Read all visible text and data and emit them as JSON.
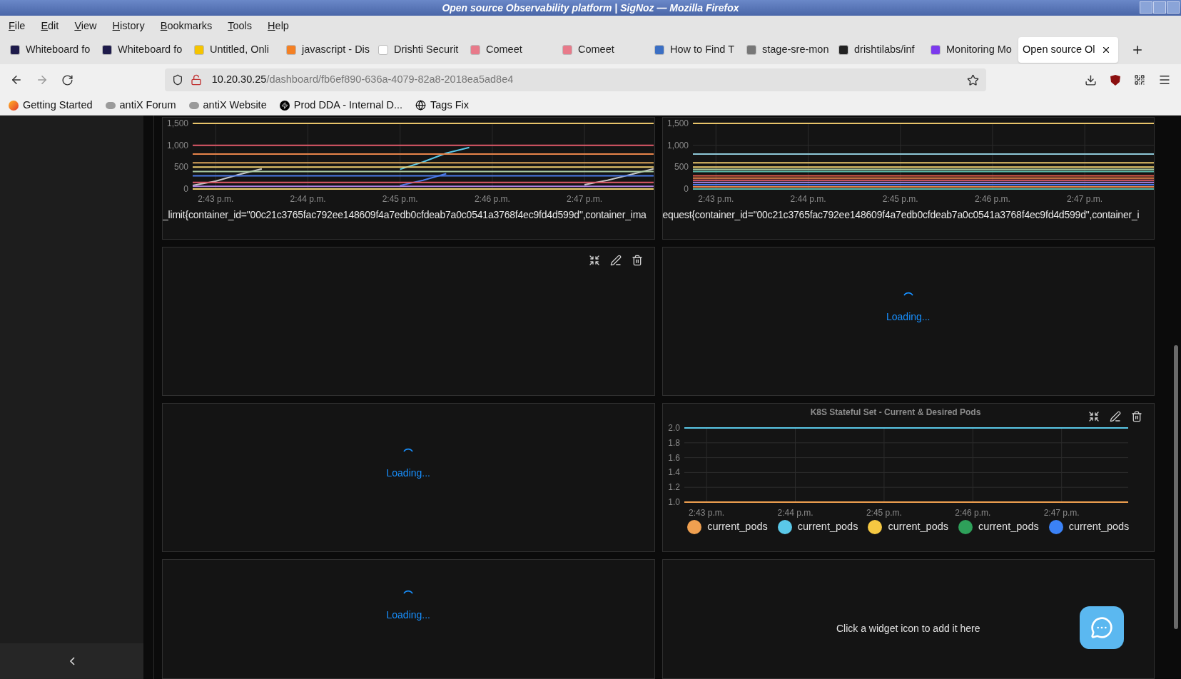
{
  "window": {
    "title": "Open source Observability platform | SigNoz — Mozilla Firefox"
  },
  "menu": [
    "File",
    "Edit",
    "View",
    "History",
    "Bookmarks",
    "Tools",
    "Help"
  ],
  "tabs": [
    {
      "label": "Whiteboard fo",
      "selected": false,
      "color": "#1e1b4b"
    },
    {
      "label": "Whiteboard fo",
      "selected": false,
      "color": "#1e1b4b"
    },
    {
      "label": "Untitled, Onli",
      "selected": false,
      "color": "#f5c400"
    },
    {
      "label": "javascript - Dis",
      "selected": false,
      "color": "#f48024"
    },
    {
      "label": "Drishti Securit",
      "selected": false,
      "color": "#ffffff"
    },
    {
      "label": "Comeet",
      "selected": false,
      "color": "#e87a8a"
    },
    {
      "label": "Comeet",
      "selected": false,
      "color": "#e87a8a"
    },
    {
      "label": "How to Find T",
      "selected": false,
      "color": "#3b6fc4"
    },
    {
      "label": "stage-sre-mon",
      "selected": false,
      "color": "#777777"
    },
    {
      "label": "drishtilabs/inf",
      "selected": false,
      "color": "#222222"
    },
    {
      "label": "Monitoring Mo",
      "selected": false,
      "color": "#7c3aed"
    },
    {
      "label": "Open source Ol",
      "selected": true
    }
  ],
  "address": {
    "host": "10.20.30.25",
    "path": "/dashboard/fb6ef890-636a-4079-82a8-2018ea5ad8e4"
  },
  "bookmarks": [
    "Getting Started",
    "antiX Forum",
    "antiX Website",
    "Prod DDA - Internal D...",
    "Tags Fix"
  ],
  "panels": [
    {
      "kind": "chart",
      "toolbar": false,
      "legend_text": "_limit{container_id=\"00c21c3765fac792ee148609f4a7edb0cfdeab7a0c0541a3768f4ec9fd4d599d\",container_ima",
      "chart_data": {
        "type": "line",
        "grid": true,
        "categories": [
          null,
          "2:43 p.m.",
          null,
          null,
          null,
          "2:44 p.m.",
          null,
          null,
          null,
          "2:45 p.m.",
          null,
          null,
          null,
          "2:46 p.m.",
          null,
          null,
          null,
          "2:47 p.m.",
          null,
          null,
          null
        ],
        "ylim": [
          0,
          1500
        ],
        "yticks": [
          {
            "value": 0,
            "label": "0"
          },
          {
            "value": 500,
            "label": "500"
          },
          {
            "value": 1000,
            "label": "1,000"
          },
          {
            "value": 1500,
            "label": "1,500"
          }
        ],
        "series": [
          {
            "color": "#e8c46a",
            "values": [
              1500,
              1500,
              1500,
              1500,
              1500,
              1500,
              1500,
              1500,
              1500,
              1500,
              1500,
              1500,
              1500,
              1500,
              1500,
              1500,
              1500,
              1500,
              1500,
              1500,
              1500
            ]
          },
          {
            "color": "#e05a6a",
            "values": [
              1000,
              1000,
              1000,
              1000,
              1000,
              1000,
              1000,
              1000,
              1000,
              1000,
              1000,
              1000,
              1000,
              1000,
              1000,
              1000,
              1000,
              1000,
              1000,
              1000,
              1000
            ]
          },
          {
            "color": "#e8844a",
            "values": [
              800,
              800,
              800,
              800,
              800,
              800,
              800,
              800,
              800,
              800,
              800,
              800,
              800,
              800,
              800,
              800,
              800,
              800,
              800,
              800,
              800
            ]
          },
          {
            "color": "#d9a55a",
            "values": [
              600,
              600,
              600,
              600,
              600,
              600,
              600,
              600,
              600,
              600,
              600,
              600,
              600,
              600,
              600,
              600,
              600,
              600,
              600,
              600,
              600
            ]
          },
          {
            "color": "#f0d070",
            "values": [
              500,
              500,
              500,
              500,
              500,
              500,
              500,
              500,
              500,
              500,
              500,
              500,
              500,
              500,
              500,
              500,
              500,
              500,
              500,
              500,
              500
            ]
          },
          {
            "color": "#a8c8a0",
            "values": [
              400,
              400,
              400,
              400,
              400,
              400,
              400,
              400,
              400,
              400,
              400,
              400,
              400,
              400,
              400,
              400,
              400,
              400,
              400,
              400,
              400
            ]
          },
          {
            "color": "#4a7ae8",
            "values": [
              300,
              300,
              300,
              300,
              300,
              300,
              300,
              300,
              300,
              300,
              300,
              300,
              300,
              300,
              300,
              300,
              300,
              300,
              300,
              300,
              300
            ]
          },
          {
            "color": "#e05a6a",
            "values": [
              150,
              150,
              150,
              150,
              150,
              150,
              150,
              150,
              150,
              150,
              150,
              150,
              150,
              150,
              150,
              150,
              150,
              150,
              150,
              150,
              150
            ]
          },
          {
            "color": "#b080e0",
            "values": [
              60,
              60,
              60,
              60,
              60,
              60,
              60,
              60,
              60,
              60,
              60,
              60,
              60,
              60,
              60,
              60,
              60,
              60,
              60,
              60,
              60
            ]
          },
          {
            "color": "#f0d070",
            "values": [
              0,
              0,
              0,
              0,
              0,
              0,
              0,
              0,
              0,
              0,
              0,
              0,
              0,
              0,
              0,
              0,
              0,
              0,
              0,
              0,
              0
            ]
          },
          {
            "color": "#5ac8e8",
            "values": [
              null,
              null,
              null,
              null,
              null,
              null,
              null,
              null,
              null,
              450,
              620,
              820,
              950,
              null,
              null,
              null,
              null,
              null,
              null,
              null,
              null
            ]
          },
          {
            "color": "#c8c8c8",
            "values": [
              80,
              180,
              330,
              460,
              null,
              null,
              null,
              null,
              null,
              null,
              null,
              null,
              null,
              null,
              null,
              null,
              null,
              100,
              200,
              330,
              460
            ]
          },
          {
            "color": "#4a7ae8",
            "values": [
              null,
              null,
              null,
              null,
              null,
              null,
              null,
              null,
              null,
              80,
              200,
              350,
              null,
              null,
              null,
              null,
              null,
              null,
              null,
              null,
              null
            ]
          }
        ]
      }
    },
    {
      "kind": "chart",
      "toolbar": false,
      "legend_text": "equest{container_id=\"00c21c3765fac792ee148609f4a7edb0cfdeab7a0c0541a3768f4ec9fd4d599d\",container_i",
      "chart_data": {
        "type": "line",
        "grid": true,
        "categories": [
          null,
          "2:43 p.m.",
          null,
          null,
          null,
          "2:44 p.m.",
          null,
          null,
          null,
          "2:45 p.m.",
          null,
          null,
          null,
          "2:46 p.m.",
          null,
          null,
          null,
          "2:47 p.m.",
          null,
          null,
          null
        ],
        "ylim": [
          0,
          1500
        ],
        "yticks": [
          {
            "value": 0,
            "label": "0"
          },
          {
            "value": 500,
            "label": "500"
          },
          {
            "value": 1000,
            "label": "1,000"
          },
          {
            "value": 1500,
            "label": "1,500"
          }
        ],
        "series": [
          {
            "color": "#e8c46a",
            "values": [
              1500,
              1500,
              1500,
              1500,
              1500,
              1500,
              1500,
              1500,
              1500,
              1500,
              1500,
              1500,
              1500,
              1500,
              1500,
              1500,
              1500,
              1500,
              1500,
              1500,
              1500
            ]
          },
          {
            "color": "#8ec8d8",
            "values": [
              800,
              800,
              800,
              800,
              800,
              800,
              800,
              800,
              800,
              800,
              800,
              800,
              800,
              800,
              800,
              800,
              800,
              800,
              800,
              800,
              800
            ]
          },
          {
            "color": "#e8c46a",
            "values": [
              600,
              600,
              600,
              600,
              600,
              600,
              600,
              600,
              600,
              600,
              600,
              600,
              600,
              600,
              600,
              600,
              600,
              600,
              600,
              600,
              600
            ]
          },
          {
            "color": "#f0d070",
            "values": [
              500,
              500,
              500,
              500,
              500,
              500,
              500,
              500,
              500,
              500,
              500,
              500,
              500,
              500,
              500,
              500,
              500,
              500,
              500,
              500,
              500
            ]
          },
          {
            "color": "#a8c8a0",
            "values": [
              450,
              450,
              450,
              450,
              450,
              450,
              450,
              450,
              450,
              450,
              450,
              450,
              450,
              450,
              450,
              450,
              450,
              450,
              450,
              450,
              450
            ]
          },
          {
            "color": "#5ab8a8",
            "values": [
              400,
              400,
              400,
              400,
              400,
              400,
              400,
              400,
              400,
              400,
              400,
              400,
              400,
              400,
              400,
              400,
              400,
              400,
              400,
              400,
              400
            ]
          },
          {
            "color": "#e05a4a",
            "values": [
              300,
              300,
              300,
              300,
              300,
              300,
              300,
              300,
              300,
              300,
              300,
              300,
              300,
              300,
              300,
              300,
              300,
              300,
              300,
              300,
              300
            ]
          },
          {
            "color": "#e8844a",
            "values": [
              250,
              250,
              250,
              250,
              250,
              250,
              250,
              250,
              250,
              250,
              250,
              250,
              250,
              250,
              250,
              250,
              250,
              250,
              250,
              250,
              250
            ]
          },
          {
            "color": "#e05a6a",
            "values": [
              200,
              200,
              200,
              200,
              200,
              200,
              200,
              200,
              200,
              200,
              200,
              200,
              200,
              200,
              200,
              200,
              200,
              200,
              200,
              200,
              200
            ]
          },
          {
            "color": "#b080e0",
            "values": [
              150,
              150,
              150,
              150,
              150,
              150,
              150,
              150,
              150,
              150,
              150,
              150,
              150,
              150,
              150,
              150,
              150,
              150,
              150,
              150,
              150
            ]
          },
          {
            "color": "#4a7ae8",
            "values": [
              100,
              100,
              100,
              100,
              100,
              100,
              100,
              100,
              100,
              100,
              100,
              100,
              100,
              100,
              100,
              100,
              100,
              100,
              100,
              100,
              100
            ]
          },
          {
            "color": "#e8844a",
            "values": [
              50,
              50,
              50,
              50,
              50,
              50,
              50,
              50,
              50,
              50,
              50,
              50,
              50,
              50,
              50,
              50,
              50,
              50,
              50,
              50,
              50
            ]
          },
          {
            "color": "#5ab8a8",
            "values": [
              0,
              0,
              0,
              0,
              0,
              0,
              0,
              0,
              0,
              0,
              0,
              0,
              0,
              0,
              0,
              0,
              0,
              0,
              0,
              0,
              0
            ]
          }
        ]
      }
    },
    {
      "kind": "empty",
      "toolbar": true
    },
    {
      "kind": "loading",
      "toolbar": false,
      "text": "Loading..."
    },
    {
      "kind": "loading",
      "toolbar": false,
      "text": "Loading..."
    },
    {
      "kind": "chart",
      "toolbar": true,
      "chart_data": {
        "type": "line",
        "grid": true,
        "title": "K8S Stateful Set - Current & Desired Pods",
        "categories": [
          null,
          "2:43 p.m.",
          null,
          null,
          null,
          "2:44 p.m.",
          null,
          null,
          null,
          "2:45 p.m.",
          null,
          null,
          null,
          "2:46 p.m.",
          null,
          null,
          null,
          "2:47 p.m.",
          null,
          null,
          null
        ],
        "ylim": [
          1,
          2
        ],
        "yticks": [
          {
            "value": 1,
            "label": "1.0"
          },
          {
            "value": 1.2,
            "label": "1.2"
          },
          {
            "value": 1.4,
            "label": "1.4"
          },
          {
            "value": 1.6,
            "label": "1.6"
          },
          {
            "value": 1.8,
            "label": "1.8"
          },
          {
            "value": 2,
            "label": "2.0"
          }
        ],
        "series": [
          {
            "name": "current_pods",
            "color": "#f0a050",
            "values": [
              1,
              1,
              1,
              1,
              1,
              1,
              1,
              1,
              1,
              1,
              1,
              1,
              1,
              1,
              1,
              1,
              1,
              1,
              1,
              1,
              1
            ]
          },
          {
            "name": "current_pods",
            "color": "#5ac8e8",
            "values": [
              2,
              2,
              2,
              2,
              2,
              2,
              2,
              2,
              2,
              2,
              2,
              2,
              2,
              2,
              2,
              2,
              2,
              2,
              2,
              2,
              2
            ]
          },
          {
            "name": "current_pods",
            "color": "#f5c842",
            "values": [
              null,
              null,
              null,
              null,
              null,
              null,
              null,
              null,
              null,
              null,
              null,
              null,
              null,
              null,
              null,
              null,
              null,
              null,
              null,
              null,
              null
            ]
          },
          {
            "name": "current_pods",
            "color": "#2ea05a",
            "values": [
              null,
              null,
              null,
              null,
              null,
              null,
              null,
              null,
              null,
              null,
              null,
              null,
              null,
              null,
              null,
              null,
              null,
              null,
              null,
              null,
              null
            ]
          },
          {
            "name": "current_pods",
            "color": "#3b82f6",
            "values": [
              null,
              null,
              null,
              null,
              null,
              null,
              null,
              null,
              null,
              null,
              null,
              null,
              null,
              null,
              null,
              null,
              null,
              null,
              null,
              null,
              null
            ]
          }
        ]
      }
    },
    {
      "kind": "loading",
      "toolbar": false,
      "text": "Loading..."
    },
    {
      "kind": "placeholder",
      "toolbar": false,
      "text": "Click a widget icon to add it here"
    }
  ]
}
